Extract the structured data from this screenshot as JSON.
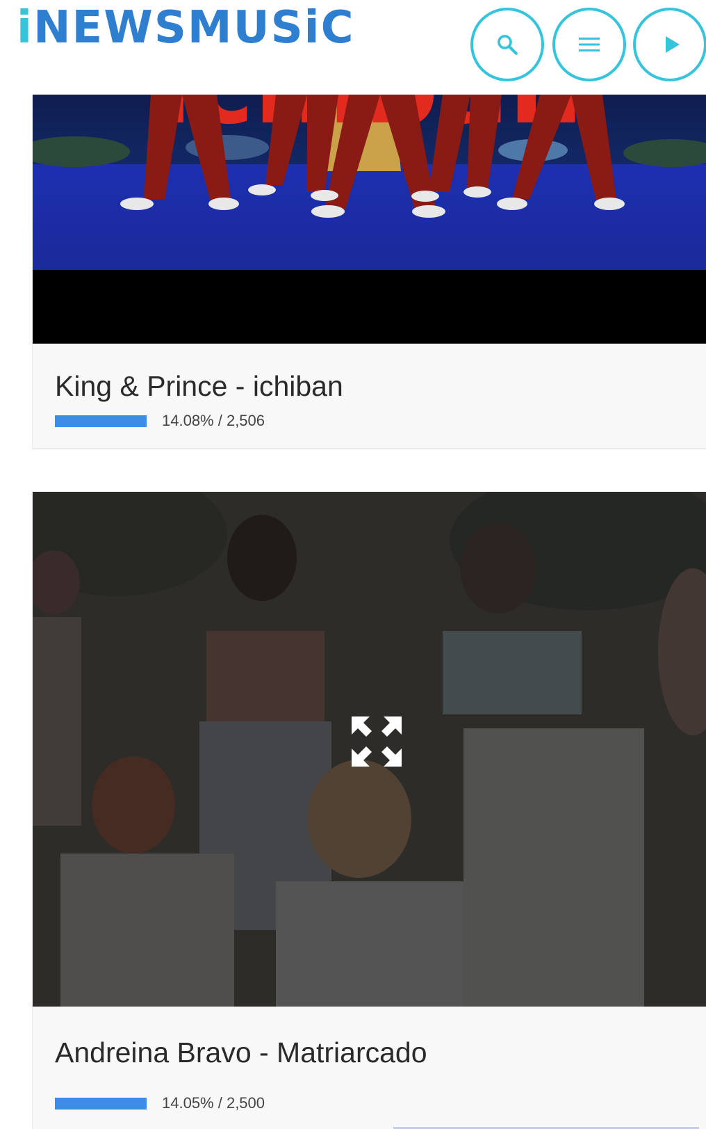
{
  "header": {
    "logo_text_accent": "i",
    "logo_text": "NEWSMUSiC",
    "accent_color": "#35c4dc",
    "brand_color": "#2f7fd1",
    "buttons": {
      "search_icon": "search-icon",
      "menu_icon": "menu-icon",
      "play_icon": "play-icon"
    }
  },
  "cards": [
    {
      "title": "King & Prince - ichiban",
      "vote_percent": 14.08,
      "vote_text": "14.08% / 2,506",
      "thumbnail_text": "ichiban",
      "bar_color": "#3b8de8"
    },
    {
      "title": "Andreina Bravo - Matriarcado",
      "vote_percent": 14.05,
      "vote_text": "14.05% / 2,500",
      "overlay_icon": "expand-icon",
      "bar_color": "#3b8de8"
    }
  ]
}
